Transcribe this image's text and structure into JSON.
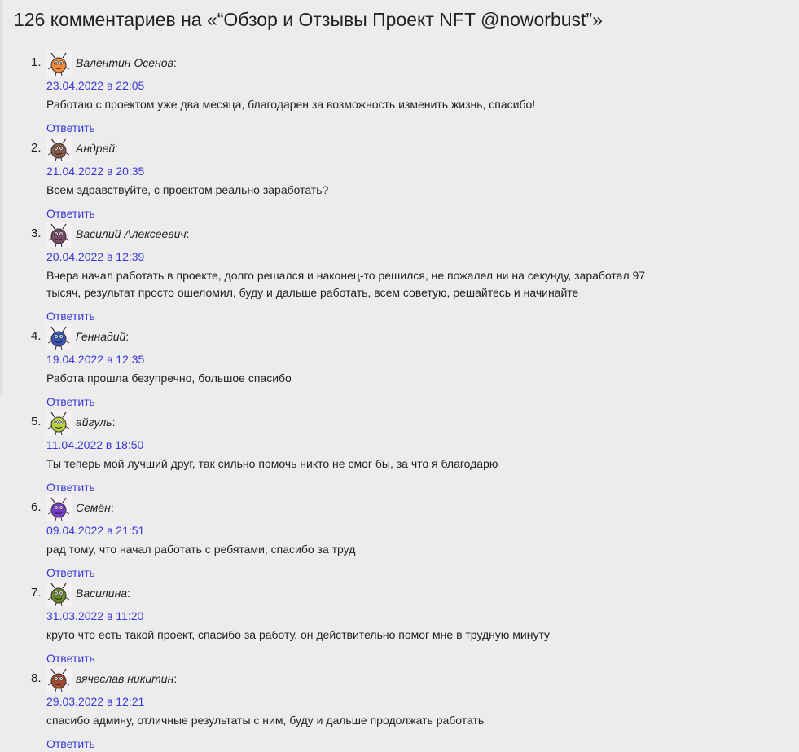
{
  "heading": "126 комментариев на «“Обзор и Отзывы Проект NFT @noworbust”»",
  "reply_label": "Ответить",
  "comments": [
    {
      "number": "1.",
      "author": "Валентин Осенов",
      "date": "23.04.2022 в 22:05",
      "text": "Работаю с проектом уже два месяца, благодарен за возможность изменить жизнь, спасибо!",
      "avatar_color": "#f08a3c"
    },
    {
      "number": "2.",
      "author": "Андрей",
      "date": "21.04.2022 в 20:35",
      "text": "Всем здравствуйте, с проектом реально заработать?",
      "avatar_color": "#8a5a4a"
    },
    {
      "number": "3.",
      "author": "Василий Алексеевич",
      "date": "20.04.2022 в 12:39",
      "text": "Вчера начал работать в проекте, долго решался и наконец-то решился, не пожалел ни на секунду, заработал 97 тысяч, результат просто ошеломил, буду и дальше работать, всем советую, решайтесь и начинайте",
      "avatar_color": "#7a4a6a"
    },
    {
      "number": "4.",
      "author": "Геннадий",
      "date": "19.04.2022 в 12:35",
      "text": "Работа прошла безупречно, большое спасибо",
      "avatar_color": "#3a56b8"
    },
    {
      "number": "5.",
      "author": "айгуль",
      "date": "11.04.2022 в 18:50",
      "text": "Ты теперь мой лучший друг, так сильно помочь никто не смог бы, за что я благодарю",
      "avatar_color": "#b8d040"
    },
    {
      "number": "6.",
      "author": "Семён",
      "date": "09.04.2022 в 21:51",
      "text": "рад тому, что начал работать с ребятами, спасибо за труд",
      "avatar_color": "#7a3ad0"
    },
    {
      "number": "7.",
      "author": "Василина",
      "date": "31.03.2022 в 11:20",
      "text": "круто что есть такой проект, спасибо за работу, он действительно помог мне в трудную минуту",
      "avatar_color": "#6a8a2a"
    },
    {
      "number": "8.",
      "author": "вячеслав никитин",
      "date": "29.03.2022 в 12:21",
      "text": "спасибо админу, отличные результаты с ним, буду и дальше продолжать работать",
      "avatar_color": "#a04a30"
    }
  ]
}
